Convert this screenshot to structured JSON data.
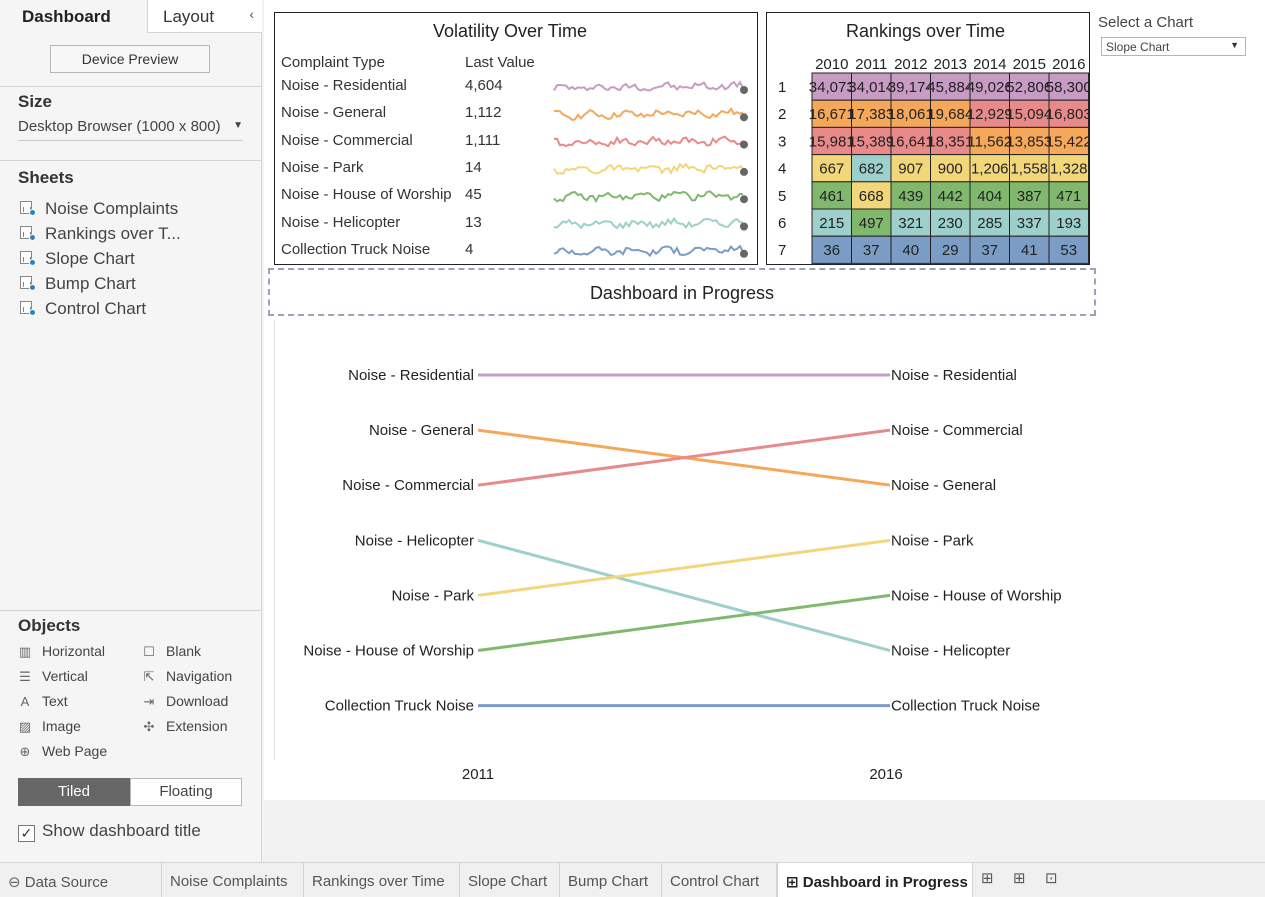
{
  "left_panel": {
    "tab_dashboard": "Dashboard",
    "tab_layout": "Layout",
    "device_preview": "Device Preview",
    "size_title": "Size",
    "size_value": "Desktop Browser (1000 x 800)",
    "sheets_title": "Sheets",
    "sheets": [
      "Noise Complaints",
      "Rankings over T...",
      "Slope Chart",
      "Bump Chart",
      "Control Chart"
    ],
    "objects_title": "Objects",
    "objects": [
      {
        "label": "Horizontal",
        "icon": "horizontal-icon"
      },
      {
        "label": "Blank",
        "icon": "blank-icon"
      },
      {
        "label": "Vertical",
        "icon": "vertical-icon"
      },
      {
        "label": "Navigation",
        "icon": "navigation-icon"
      },
      {
        "label": "Text",
        "icon": "text-icon"
      },
      {
        "label": "Download",
        "icon": "download-icon"
      },
      {
        "label": "Image",
        "icon": "image-icon"
      },
      {
        "label": "Extension",
        "icon": "extension-icon"
      },
      {
        "label": "Web Page",
        "icon": "web-page-icon"
      }
    ],
    "tiled": "Tiled",
    "floating": "Floating",
    "show_title": "Show dashboard title"
  },
  "volatility": {
    "title": "Volatility Over Time",
    "col_type": "Complaint Type",
    "col_value": "Last Value",
    "rows": [
      {
        "type": "Noise - Residential",
        "value": "4,604",
        "color": "#c79bc4"
      },
      {
        "type": "Noise - General",
        "value": "1,112",
        "color": "#f5a85a"
      },
      {
        "type": "Noise - Commercial",
        "value": "1,111",
        "color": "#e98a8a"
      },
      {
        "type": "Noise - Park",
        "value": "14",
        "color": "#f2d77a"
      },
      {
        "type": "Noise - House of Worship",
        "value": "45",
        "color": "#80b86e"
      },
      {
        "type": "Noise - Helicopter",
        "value": "13",
        "color": "#9dd0ca"
      },
      {
        "type": "Collection Truck Noise",
        "value": "4",
        "color": "#7b9cc4"
      }
    ]
  },
  "rankings": {
    "title": "Rankings over Time",
    "years": [
      "2010",
      "2011",
      "2012",
      "2013",
      "2014",
      "2015",
      "2016"
    ],
    "ranks": [
      "1",
      "2",
      "3",
      "4",
      "5",
      "6",
      "7"
    ],
    "cells": [
      [
        {
          "v": "34,073",
          "c": "#c79bc4"
        },
        {
          "v": "34,014",
          "c": "#c79bc4"
        },
        {
          "v": "39,174",
          "c": "#c79bc4"
        },
        {
          "v": "45,884",
          "c": "#c79bc4"
        },
        {
          "v": "49,026",
          "c": "#c79bc4"
        },
        {
          "v": "52,806",
          "c": "#c79bc4"
        },
        {
          "v": "58,300",
          "c": "#c79bc4"
        }
      ],
      [
        {
          "v": "16,671",
          "c": "#f5a85a"
        },
        {
          "v": "17,383",
          "c": "#f5a85a"
        },
        {
          "v": "18,061",
          "c": "#f5a85a"
        },
        {
          "v": "19,684",
          "c": "#f5a85a"
        },
        {
          "v": "12,929",
          "c": "#e98a8a"
        },
        {
          "v": "15,094",
          "c": "#e98a8a"
        },
        {
          "v": "16,803",
          "c": "#e98a8a"
        }
      ],
      [
        {
          "v": "15,981",
          "c": "#e98a8a"
        },
        {
          "v": "15,389",
          "c": "#e98a8a"
        },
        {
          "v": "16,641",
          "c": "#e98a8a"
        },
        {
          "v": "18,351",
          "c": "#e98a8a"
        },
        {
          "v": "11,562",
          "c": "#f5a85a"
        },
        {
          "v": "13,853",
          "c": "#f5a85a"
        },
        {
          "v": "15,422",
          "c": "#f5a85a"
        }
      ],
      [
        {
          "v": "667",
          "c": "#f2d77a"
        },
        {
          "v": "682",
          "c": "#9dd0ca"
        },
        {
          "v": "907",
          "c": "#f2d77a"
        },
        {
          "v": "900",
          "c": "#f2d77a"
        },
        {
          "v": "1,206",
          "c": "#f2d77a"
        },
        {
          "v": "1,558",
          "c": "#f2d77a"
        },
        {
          "v": "1,328",
          "c": "#f2d77a"
        }
      ],
      [
        {
          "v": "461",
          "c": "#80b86e"
        },
        {
          "v": "668",
          "c": "#f2d77a"
        },
        {
          "v": "439",
          "c": "#80b86e"
        },
        {
          "v": "442",
          "c": "#80b86e"
        },
        {
          "v": "404",
          "c": "#80b86e"
        },
        {
          "v": "387",
          "c": "#80b86e"
        },
        {
          "v": "471",
          "c": "#80b86e"
        }
      ],
      [
        {
          "v": "215",
          "c": "#9dd0ca"
        },
        {
          "v": "497",
          "c": "#80b86e"
        },
        {
          "v": "321",
          "c": "#9dd0ca"
        },
        {
          "v": "230",
          "c": "#9dd0ca"
        },
        {
          "v": "285",
          "c": "#9dd0ca"
        },
        {
          "v": "337",
          "c": "#9dd0ca"
        },
        {
          "v": "193",
          "c": "#9dd0ca"
        }
      ],
      [
        {
          "v": "36",
          "c": "#7b9cc4"
        },
        {
          "v": "37",
          "c": "#7b9cc4"
        },
        {
          "v": "40",
          "c": "#7b9cc4"
        },
        {
          "v": "29",
          "c": "#7b9cc4"
        },
        {
          "v": "37",
          "c": "#7b9cc4"
        },
        {
          "v": "41",
          "c": "#7b9cc4"
        },
        {
          "v": "53",
          "c": "#7b9cc4"
        }
      ]
    ]
  },
  "select_chart": {
    "label": "Select a Chart",
    "value": "Slope Chart"
  },
  "dashboard_title": "Dashboard in Progress",
  "chart_data": {
    "type": "line",
    "subtype": "slope",
    "x": [
      "2011",
      "2016"
    ],
    "y_axis": "rank (1 = top)",
    "series": [
      {
        "name": "Noise - Residential",
        "ranks": [
          1,
          1
        ],
        "color": "#c79bc4"
      },
      {
        "name": "Noise - General",
        "ranks": [
          2,
          3
        ],
        "color": "#f5a85a"
      },
      {
        "name": "Noise - Commercial",
        "ranks": [
          3,
          2
        ],
        "color": "#e98a8a"
      },
      {
        "name": "Noise - Helicopter",
        "ranks": [
          4,
          6
        ],
        "color": "#9dd0ca"
      },
      {
        "name": "Noise - Park",
        "ranks": [
          5,
          4
        ],
        "color": "#f2d77a"
      },
      {
        "name": "Noise - House of Worship",
        "ranks": [
          6,
          5
        ],
        "color": "#80b86e"
      },
      {
        "name": "Collection Truck Noise",
        "ranks": [
          7,
          7
        ],
        "color": "#7b9cc4"
      }
    ]
  },
  "bottom_tabs": {
    "data_source": "Data Source",
    "tabs": [
      "Noise Complaints",
      "Rankings over Time",
      "Slope Chart",
      "Bump Chart",
      "Control Chart",
      "Dashboard in Progress"
    ]
  }
}
